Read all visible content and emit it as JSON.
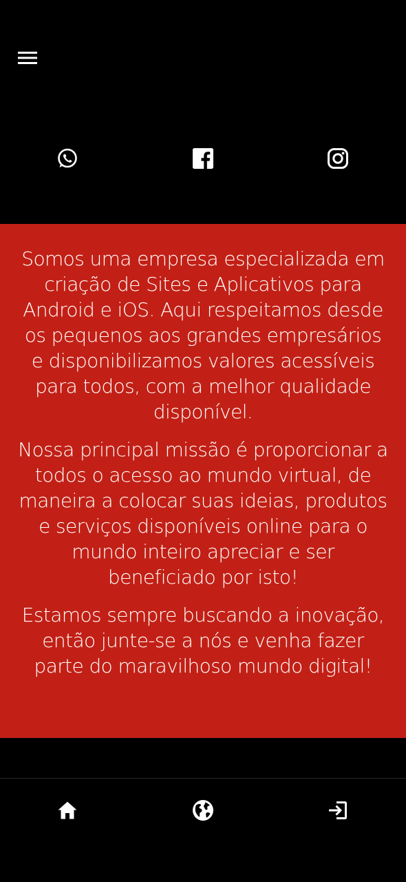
{
  "header": {
    "menu_icon": "hamburger-menu-icon"
  },
  "social": [
    {
      "name": "whatsapp",
      "icon": "whatsapp-icon"
    },
    {
      "name": "facebook",
      "icon": "facebook-icon"
    },
    {
      "name": "instagram",
      "icon": "instagram-icon"
    }
  ],
  "about": {
    "paragraphs": [
      "Somos uma empresa especializada em criação de Sites e Aplicativos para Android e iOS. Aqui respeitamos desde os pequenos aos grandes empresários e disponibilizamos valores acessíveis para todos, com a melhor qualidade disponível.",
      "Nossa principal missão é proporcionar a todos o acesso ao mundo virtual, de maneira a colocar suas ideias, produtos e serviços disponíveis online para o mundo inteiro apreciar e ser beneficiado por isto!",
      "Estamos sempre buscando a inovação, então junte-se a nós e venha fazer parte do maravilhoso mundo digital!"
    ]
  },
  "bottom_nav": [
    {
      "name": "home",
      "icon": "home-icon"
    },
    {
      "name": "website",
      "icon": "globe-icon"
    },
    {
      "name": "exit",
      "icon": "exit-icon"
    }
  ],
  "colors": {
    "background": "#000000",
    "accent": "#c22016",
    "text": "#ffffff"
  }
}
